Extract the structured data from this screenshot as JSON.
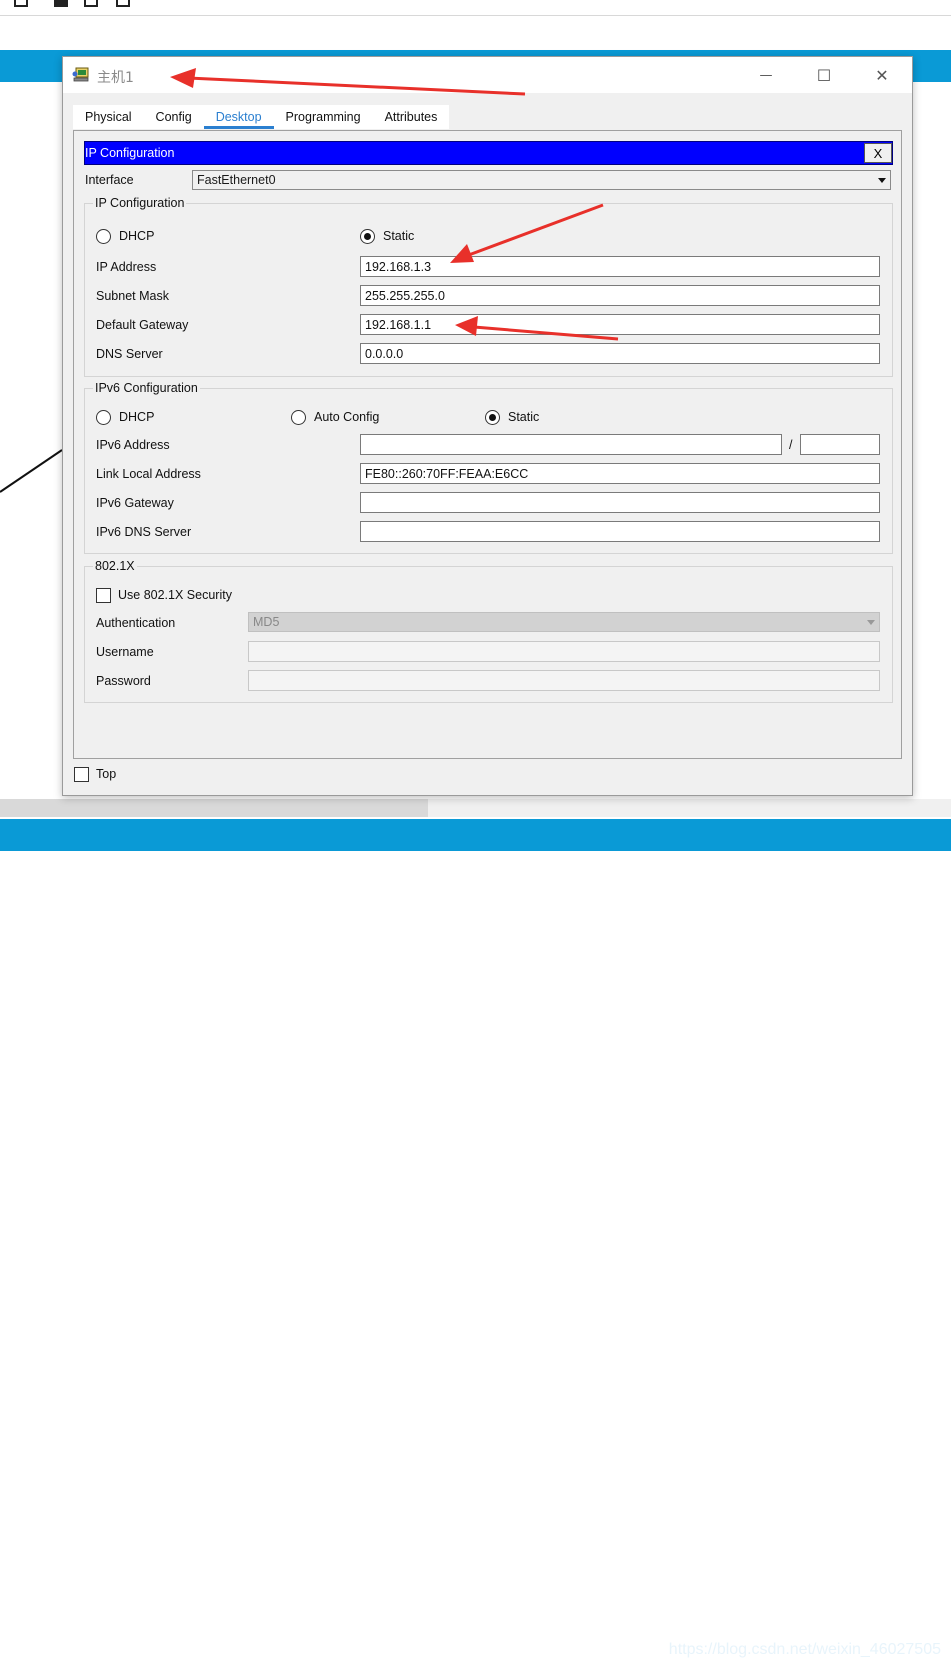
{
  "window": {
    "title": "主机1",
    "minimize_glyph": "—",
    "maximize_glyph": "☐",
    "close_glyph": "✕"
  },
  "tabs": [
    {
      "label": "Physical",
      "active": false
    },
    {
      "label": "Config",
      "active": false
    },
    {
      "label": "Desktop",
      "active": true
    },
    {
      "label": "Programming",
      "active": false
    },
    {
      "label": "Attributes",
      "active": false
    }
  ],
  "ip_config": {
    "header_title": "IP Configuration",
    "close_label": "X",
    "interface_label": "Interface",
    "interface_value": "FastEthernet0",
    "ipv4": {
      "group_title": "IP Configuration",
      "dhcp_label": "DHCP",
      "static_label": "Static",
      "mode": "static",
      "ip_address_label": "IP Address",
      "ip_address_value": "192.168.1.3",
      "subnet_mask_label": "Subnet Mask",
      "subnet_mask_value": "255.255.255.0",
      "gateway_label": "Default Gateway",
      "gateway_value": "192.168.1.1",
      "dns_label": "DNS Server",
      "dns_value": "0.0.0.0"
    },
    "ipv6": {
      "group_title": "IPv6 Configuration",
      "dhcp_label": "DHCP",
      "auto_label": "Auto Config",
      "static_label": "Static",
      "mode": "static",
      "address_label": "IPv6 Address",
      "address_value": "",
      "prefix_separator": "/",
      "prefix_value": "",
      "link_local_label": "Link Local Address",
      "link_local_value": "FE80::260:70FF:FEAA:E6CC",
      "gateway_label": "IPv6 Gateway",
      "gateway_value": "",
      "dns_label": "IPv6 DNS Server",
      "dns_value": ""
    },
    "dot1x": {
      "group_title": "802.1X",
      "use_security_label": "Use 802.1X Security",
      "use_security_checked": false,
      "auth_label": "Authentication",
      "auth_value": "MD5",
      "username_label": "Username",
      "username_value": "",
      "password_label": "Password",
      "password_value": ""
    }
  },
  "footer": {
    "top_label": "Top",
    "top_checked": false
  },
  "watermark": "https://blog.csdn.net/weixin_46027505",
  "colors": {
    "accent_blue": "#0a9ad6",
    "header_blue": "#0000ff",
    "tab_active": "#2a7fd0",
    "annotation_arrow": "#e8302a"
  }
}
